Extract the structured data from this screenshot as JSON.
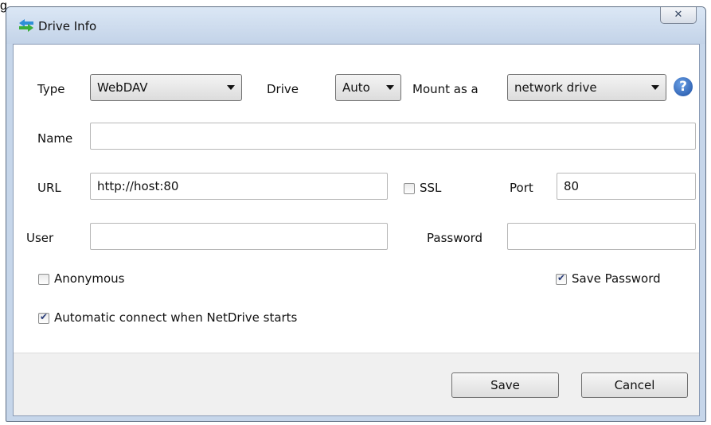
{
  "page_fragment": "g",
  "window": {
    "title": "Drive Info",
    "close_icon": "close-icon"
  },
  "form": {
    "type": {
      "label": "Type",
      "selected": "WebDAV"
    },
    "drive": {
      "label": "Drive",
      "selected": "Auto"
    },
    "mount": {
      "label": "Mount as a",
      "selected": "network drive"
    },
    "help_icon": "?",
    "name": {
      "label": "Name",
      "value": ""
    },
    "url": {
      "label": "URL",
      "value": "http://host:80"
    },
    "ssl": {
      "label": "SSL",
      "checked": false
    },
    "port": {
      "label": "Port",
      "value": "80"
    },
    "user": {
      "label": "User",
      "value": ""
    },
    "password": {
      "label": "Password",
      "value": ""
    },
    "anonymous": {
      "label": "Anonymous",
      "checked": false
    },
    "save_password": {
      "label": "Save Password",
      "checked": true
    },
    "auto_connect": {
      "label": "Automatic connect when NetDrive starts",
      "checked": true
    }
  },
  "buttons": {
    "save": "Save",
    "cancel": "Cancel"
  },
  "colors": {
    "help_icon": "#2a5fb5",
    "window_frame": "#c6d6ea"
  }
}
